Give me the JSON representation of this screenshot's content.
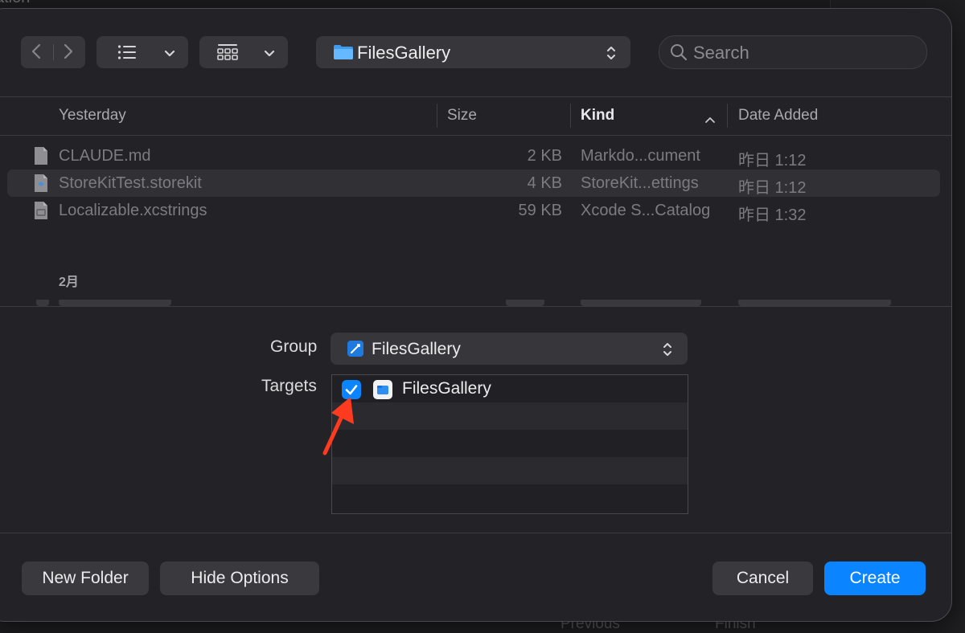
{
  "background": {
    "top_text": "ation",
    "bottom_buttons": [
      "Previous",
      "Finish"
    ]
  },
  "toolbar": {
    "path_label": "FilesGallery",
    "search_placeholder": "Search"
  },
  "columns": {
    "name": "Yesterday",
    "size": "Size",
    "kind": "Kind",
    "date": "Date Added"
  },
  "files": [
    {
      "name": "CLAUDE.md",
      "size": "2 KB",
      "kind": "Markdo...cument",
      "date": "昨日 1:12",
      "icon": "document-icon"
    },
    {
      "name": "StoreKitTest.storekit",
      "size": "4 KB",
      "kind": "StoreKit...ettings",
      "date": "昨日 1:12",
      "icon": "storekit-file-icon"
    },
    {
      "name": "Localizable.xcstrings",
      "size": "59 KB",
      "kind": "Xcode S...Catalog",
      "date": "昨日 1:32",
      "icon": "strings-catalog-icon"
    }
  ],
  "section_label": "2月",
  "options": {
    "group_label": "Group",
    "group_value": "FilesGallery",
    "targets_label": "Targets",
    "targets": [
      {
        "name": "FilesGallery",
        "checked": true
      }
    ]
  },
  "buttons": {
    "new_folder": "New Folder",
    "hide_options": "Hide Options",
    "cancel": "Cancel",
    "create": "Create"
  },
  "colors": {
    "accent": "#0a84ff",
    "annotation_arrow": "#ff3b1f"
  }
}
